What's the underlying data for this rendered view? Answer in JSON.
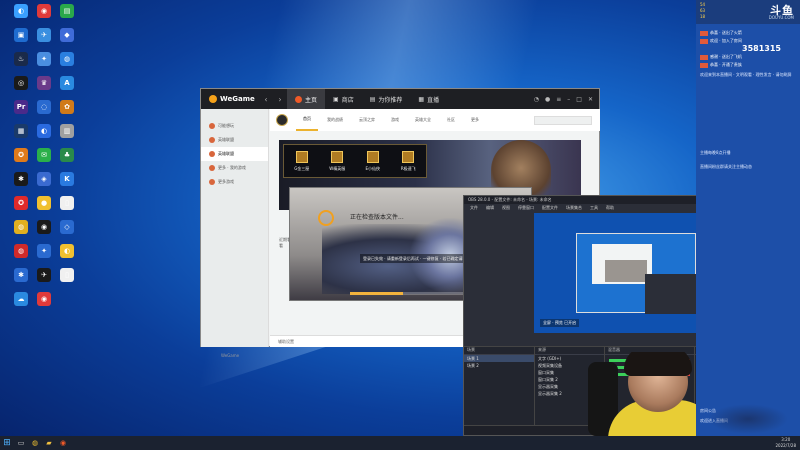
{
  "desktop": {
    "icons": [
      {
        "label": "",
        "color": "#3aa0ff",
        "glyph": "◐"
      },
      {
        "label": "",
        "color": "#e03a3a",
        "glyph": "◉"
      },
      {
        "label": "",
        "color": "#2aa84a",
        "glyph": "▤"
      },
      {
        "label": "",
        "color": "#1f6cd0",
        "glyph": "▣"
      },
      {
        "label": "",
        "color": "#3a8fe0",
        "glyph": "✈"
      },
      {
        "label": "",
        "color": "#3f6bd8",
        "glyph": "◆"
      },
      {
        "label": "",
        "color": "#1a2a4a",
        "glyph": "♨"
      },
      {
        "label": "",
        "color": "#4a8ee0",
        "glyph": "✦"
      },
      {
        "label": "",
        "color": "#2a7fe0",
        "glyph": "◍"
      },
      {
        "label": "",
        "color": "#1a1a1a",
        "glyph": "◎"
      },
      {
        "label": "",
        "color": "#6a3a8a",
        "glyph": "♛"
      },
      {
        "label": "",
        "color": "#2a8ae0",
        "glyph": "A"
      },
      {
        "label": "",
        "color": "#4a2a8a",
        "glyph": "Pr"
      },
      {
        "label": "",
        "color": "#2a6ad0",
        "glyph": "◌"
      },
      {
        "label": "",
        "color": "#d07a1a",
        "glyph": "✿"
      },
      {
        "label": "",
        "color": "#1a3a6a",
        "glyph": "▦"
      },
      {
        "label": "",
        "color": "#2a6ae0",
        "glyph": "◐"
      },
      {
        "label": "",
        "color": "#a0a0a0",
        "glyph": "▥"
      },
      {
        "label": "",
        "color": "#e07a1a",
        "glyph": "✪"
      },
      {
        "label": "",
        "color": "#2ab04a",
        "glyph": "✉"
      },
      {
        "label": "",
        "color": "#2a8a4a",
        "glyph": "♣"
      },
      {
        "label": "",
        "color": "#1a1a1a",
        "glyph": "✱"
      },
      {
        "label": "",
        "color": "#3a6ad0",
        "glyph": "◈"
      },
      {
        "label": "",
        "color": "#2a7ae0",
        "glyph": "K"
      },
      {
        "label": "",
        "color": "#e02a2a",
        "glyph": "✪"
      },
      {
        "label": "",
        "color": "#f0c030",
        "glyph": "●"
      },
      {
        "label": "",
        "color": "#f0f0f0",
        "glyph": "▯"
      },
      {
        "label": "",
        "color": "#e0b020",
        "glyph": "◍"
      },
      {
        "label": "",
        "color": "#1a1a1a",
        "glyph": "◉"
      },
      {
        "label": "",
        "color": "#2a6ad0",
        "glyph": "◇"
      },
      {
        "label": "",
        "color": "#d02a2a",
        "glyph": "◍"
      },
      {
        "label": "",
        "color": "#2a6ad0",
        "glyph": "✦"
      },
      {
        "label": "",
        "color": "#f0c030",
        "glyph": "◐"
      },
      {
        "label": "",
        "color": "#2a6ad0",
        "glyph": "✱"
      },
      {
        "label": "",
        "color": "#1a1a1a",
        "glyph": "✈"
      },
      {
        "label": "",
        "color": "#f0f0f0",
        "glyph": "▯"
      },
      {
        "label": "",
        "color": "#2a8ae0",
        "glyph": "☁"
      },
      {
        "label": "",
        "color": "#e03a3a",
        "glyph": "◉"
      }
    ]
  },
  "taskbar": {
    "start_icon": "windows-start-icon",
    "time": "3:20",
    "date": "2022/7/28"
  },
  "wegame": {
    "brand": "WeGame",
    "tabs": [
      "主页",
      "商店",
      "为你推荐",
      "直播"
    ],
    "sidebar": [
      "可能想玩",
      "英雄联盟",
      "英雄联盟",
      "更多 · 我的游戏",
      "更多游戏"
    ],
    "game_tabs": [
      "首页",
      "我的战绩",
      "云顶之弈",
      "游戏",
      "英雄大全",
      "社区",
      "更多"
    ],
    "modes": [
      "G金三屋",
      "W精英服",
      "E小仙侠",
      "R极速飞"
    ],
    "strip_label": "近期看看",
    "bottom_left": "辅助设置",
    "bottom_right": "更多 · 联系",
    "version": "WeGame"
  },
  "loading": {
    "title": "正在检查版本文件...",
    "fail_text": "登录已失效 · 请重新登录后再试 · 一键修复 · 若已确定请稍候 · 点击修复继续"
  },
  "obs": {
    "title": "OBS 28.0.0 - 配置文件: 未命名 - 场景: 未命名",
    "menu": [
      "文件",
      "编辑",
      "视图",
      "停靠窗口",
      "配置文件",
      "场景集合",
      "工具",
      "帮助"
    ],
    "preview_label": "全屏 · 预览 已开启",
    "scenes_header": "场景",
    "scenes": [
      "场景 1",
      "场景 2"
    ],
    "sources_header": "来源",
    "sources": [
      "文字 (GDI+)",
      "视频采集设备",
      "窗口采集",
      "窗口采集 2",
      "显示器采集",
      "显示器采集 2"
    ],
    "mixer_header": "混音器",
    "trans_header": "转场特效",
    "controls_header": "控制按钮",
    "controls": [
      "停止推流",
      "开始录制",
      "启动虚拟摄像机",
      "工作室模式",
      "设置",
      "退出"
    ]
  },
  "chat": {
    "stats": [
      "54",
      "63",
      "18"
    ],
    "brand": "斗鱼",
    "brand_sub": "DOUYU.COM",
    "viewers": "3581315",
    "gifts": [
      {
        "text": "恭喜 · 送出了火箭"
      },
      {
        "text": "欢迎 · 加入了房间"
      },
      {
        "text": "感谢 · 送出了飞机"
      },
      {
        "text": "恭喜 · 开通了贵族"
      }
    ],
    "notices": [
      "欢迎来到本直播间 · 文明观看 · 理性发言 · 请勿刷屏",
      "主播每晚8点开播",
      "直播间粉丝群请关注主播动态",
      "房间公告",
      "欢迎进入直播间"
    ]
  }
}
